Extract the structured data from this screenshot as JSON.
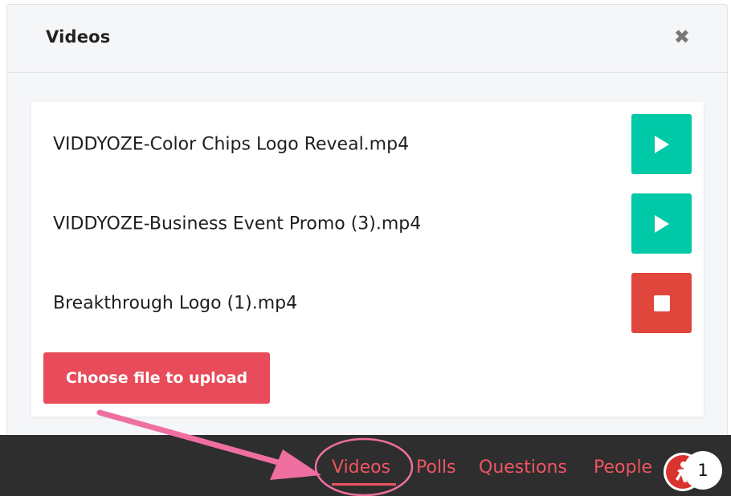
{
  "modal": {
    "title": "Videos",
    "close_icon": "close-icon",
    "close_glyph": "✖"
  },
  "videos": [
    {
      "name": "VIDDYOZE-Color Chips Logo Reveal.mp4",
      "action": "play",
      "action_icon": "play-icon",
      "color": "#00c9a7"
    },
    {
      "name": "VIDDYOZE-Business Event Promo (3).mp4",
      "action": "play",
      "action_icon": "play-icon",
      "color": "#00c9a7"
    },
    {
      "name": "Breakthrough Logo (1).mp4",
      "action": "stop",
      "action_icon": "stop-icon",
      "color": "#e0463c"
    }
  ],
  "upload": {
    "label": "Choose file to upload",
    "color": "#e84b59"
  },
  "bottom_nav": {
    "items": [
      {
        "label": "Videos",
        "active": true
      },
      {
        "label": "Polls",
        "active": false
      },
      {
        "label": "Questions",
        "active": false
      },
      {
        "label": "People",
        "active": false
      }
    ],
    "link_color": "#f05462",
    "background": "#2e2e2e"
  },
  "participants": {
    "count": "1",
    "avatar_icon": "user-avatar-icon"
  },
  "annotation": {
    "arrow_color": "#ee6fa0",
    "icon": "pointer-arrow-icon"
  }
}
